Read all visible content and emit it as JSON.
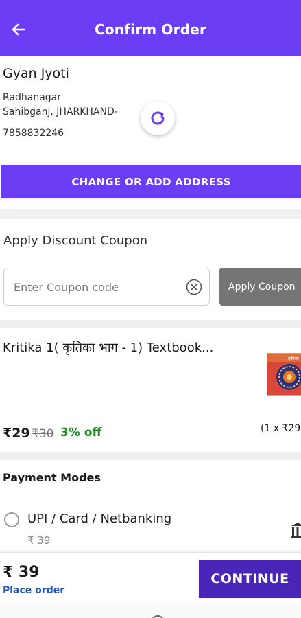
{
  "header": {
    "title": "Confirm Order",
    "back_icon": "arrow-left-icon",
    "background": "#6b3ef5"
  },
  "address": {
    "name": "Gyan Jyoti",
    "line1": "Radhanagar",
    "line2": "Sahibganj, JHARKHAND-",
    "phone": "7858832246",
    "change_button": "CHANGE OR ADD ADDRESS",
    "loader_icon": "refresh-icon"
  },
  "coupon": {
    "title": "Apply Discount Coupon",
    "placeholder": "Enter Coupon code",
    "clear_icon": "clear-circle-icon",
    "apply_button": "Apply Coupon"
  },
  "product": {
    "title": "Kritika  1( कृतिका भाग - 1) Textbook...",
    "price": "₹29",
    "mrp": "₹30",
    "discount": "3% off",
    "quantity": "(1 x ₹29)"
  },
  "payment": {
    "title": "Payment Modes",
    "option_label": "UPI / Card / Netbanking",
    "option_amount": "₹ 39",
    "option_icon": "bank-icon"
  },
  "footer": {
    "total": "₹ 39",
    "place_order": "Place order",
    "continue_button": "CONTINUE"
  },
  "colors": {
    "accent": "#6b3ef5",
    "continue": "#4a26b8",
    "discount_green": "#1e8a1e",
    "link_blue": "#1d59c9",
    "apply_gray": "#757575"
  }
}
